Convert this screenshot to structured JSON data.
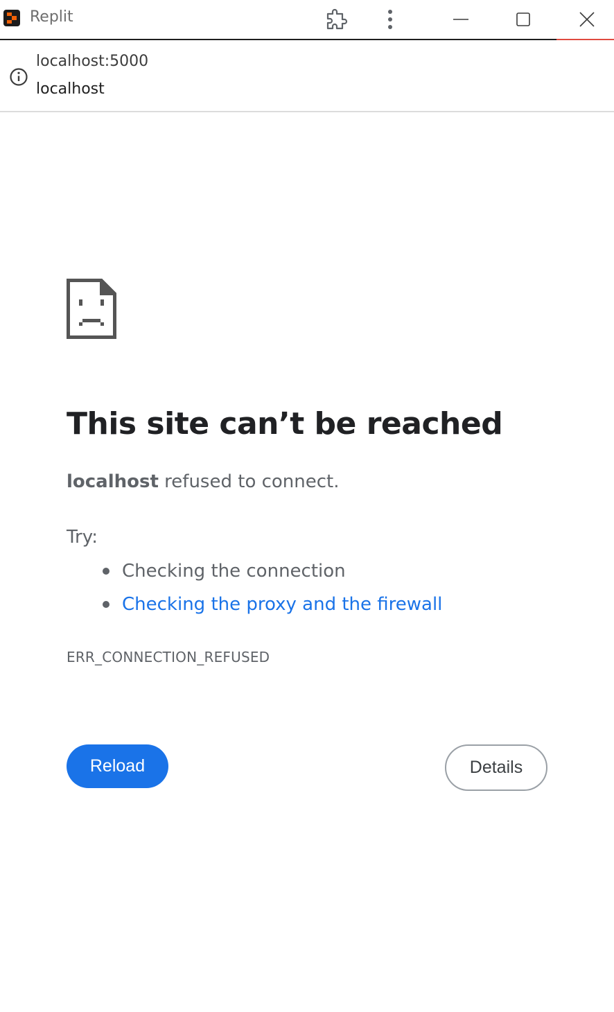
{
  "window": {
    "app_title": "Replit",
    "accent_color": "#e04a3f",
    "icons": [
      "replit-logo-icon",
      "extension-icon",
      "kebab-menu-icon",
      "minimize-icon",
      "maximize-icon",
      "close-icon"
    ]
  },
  "address": {
    "url": "localhost:5000",
    "host": "localhost",
    "icon": "info-icon"
  },
  "error_page": {
    "icon": "sad-document-icon",
    "headline": "This site can’t be reached",
    "summary_host": "localhost",
    "summary_text": " refused to connect.",
    "try_label": "Try:",
    "suggestions": [
      {
        "text": "Checking the connection",
        "is_link": false
      },
      {
        "text": "Checking the proxy and the firewall",
        "is_link": true
      }
    ],
    "error_code": "ERR_CONNECTION_REFUSED",
    "reload_label": "Reload",
    "details_label": "Details",
    "primary_color": "#1a73e8"
  }
}
